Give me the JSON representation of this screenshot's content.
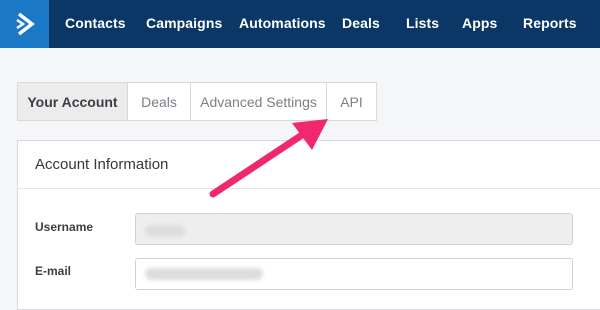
{
  "nav": {
    "items": [
      {
        "label": "Contacts"
      },
      {
        "label": "Campaigns"
      },
      {
        "label": "Automations"
      },
      {
        "label": "Deals"
      },
      {
        "label": "Lists"
      },
      {
        "label": "Apps"
      },
      {
        "label": "Reports"
      }
    ]
  },
  "tabs": [
    {
      "label": "Your Account",
      "active": true
    },
    {
      "label": "Deals",
      "active": false
    },
    {
      "label": "Advanced Settings",
      "active": false
    },
    {
      "label": "API",
      "active": false
    }
  ],
  "panel": {
    "title": "Account Information",
    "fields": [
      {
        "label": "Username",
        "value": "",
        "disabled": true
      },
      {
        "label": "E-mail",
        "value": "",
        "disabled": false
      }
    ]
  },
  "annotation": {
    "color": "#f0286e",
    "icon": "arrow-icon"
  },
  "colors": {
    "nav_bg": "#0a3765",
    "logo_bg": "#1b78c7"
  }
}
